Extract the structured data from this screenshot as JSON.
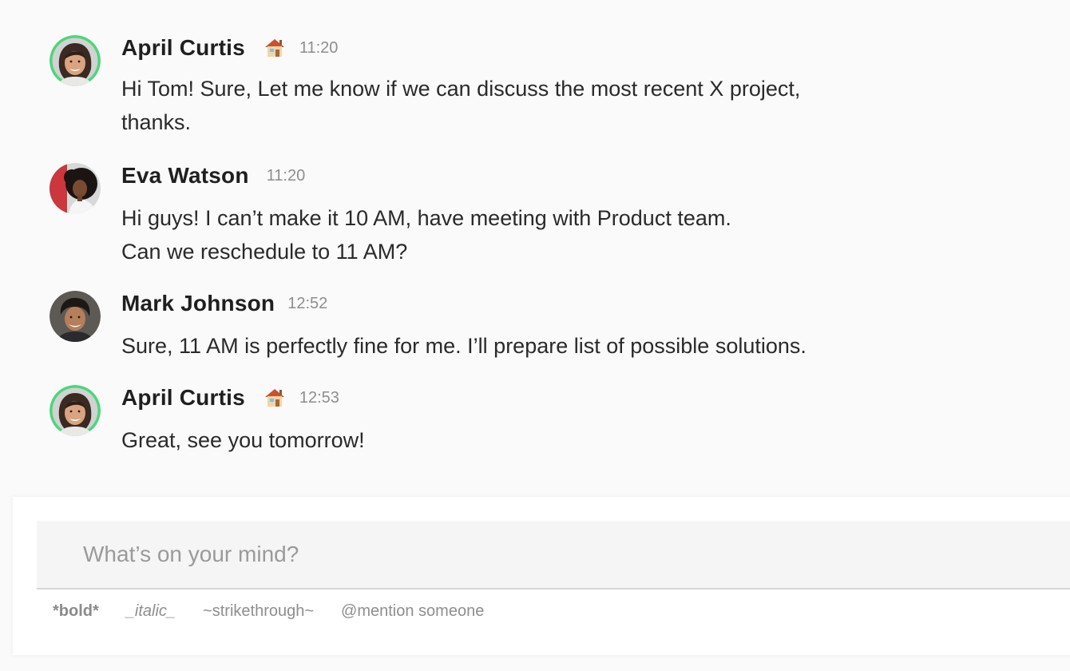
{
  "messages": [
    {
      "author": "April Curtis",
      "status_icon": "house-icon",
      "time": "11:20",
      "lines": [
        "Hi Tom! Sure, Let me know if we can discuss the most recent X project,",
        "thanks."
      ],
      "online": true
    },
    {
      "author": "Eva Watson",
      "time": "11:20",
      "lines": [
        "Hi guys! I can’t make it 10 AM, have meeting with Product team.",
        "Can we reschedule to 11 AM?"
      ],
      "online": false
    },
    {
      "author": "Mark Johnson",
      "time": "12:52",
      "lines": [
        "Sure, 11 AM is perfectly fine for me. I’ll prepare list of possible solutions."
      ],
      "online": false
    },
    {
      "author": "April Curtis",
      "status_icon": "house-icon",
      "time": "12:53",
      "lines": [
        "Great, see you tomorrow!"
      ],
      "online": true
    }
  ],
  "composer": {
    "placeholder": "What’s on your mind?",
    "value": "",
    "hints": {
      "bold": "*bold*",
      "italic": "_italic_",
      "strike": "~strikethrough~",
      "mention": "@mention someone"
    }
  },
  "colors": {
    "online_ring": "#4cd67a",
    "background": "#fafafa",
    "composer_bg": "#ffffff",
    "input_bg": "#f5f5f5",
    "timestamp": "#8e8e8e"
  }
}
